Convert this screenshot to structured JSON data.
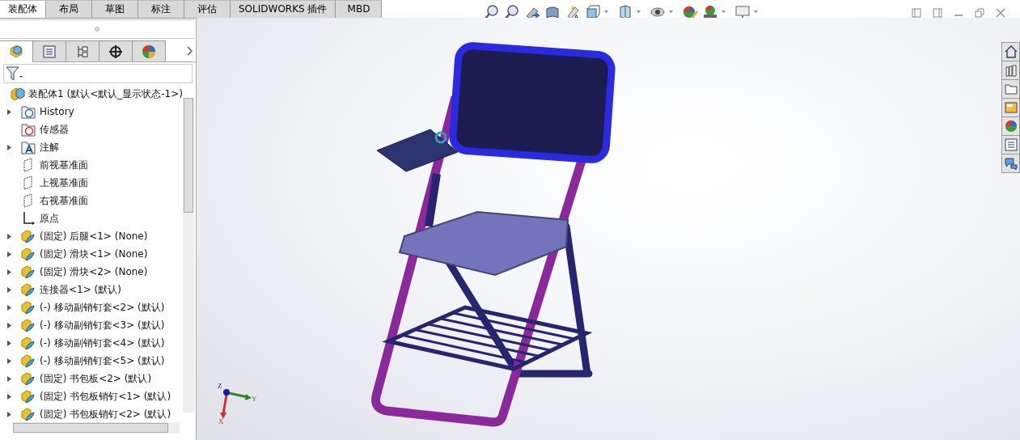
{
  "command_tabs": [
    {
      "label": "装配体",
      "selected": true
    },
    {
      "label": "布局",
      "selected": false
    },
    {
      "label": "草图",
      "selected": false
    },
    {
      "label": "标注",
      "selected": false
    },
    {
      "label": "评估",
      "selected": false
    },
    {
      "label": "SOLIDWORKS 插件",
      "selected": false
    },
    {
      "label": "MBD",
      "selected": false
    }
  ],
  "panel_tabs": [
    {
      "kind": "feature",
      "selected": true
    },
    {
      "kind": "property",
      "selected": false
    },
    {
      "kind": "config",
      "selected": false
    },
    {
      "kind": "dim",
      "selected": false
    },
    {
      "kind": "display",
      "selected": false
    }
  ],
  "tree": {
    "root": "装配体1  (默认<默认_显示状态-1>)",
    "items": [
      {
        "kind": "history",
        "label": "History",
        "expandable": true
      },
      {
        "kind": "sensor",
        "label": "传感器",
        "expandable": false
      },
      {
        "kind": "annotation",
        "label": "注解",
        "expandable": true
      },
      {
        "kind": "plane",
        "label": "前视基准面",
        "expandable": false
      },
      {
        "kind": "plane",
        "label": "上视基准面",
        "expandable": false
      },
      {
        "kind": "plane",
        "label": "右视基准面",
        "expandable": false
      },
      {
        "kind": "origin",
        "label": "原点",
        "expandable": false
      },
      {
        "kind": "part",
        "label": "(固定) 后腿<1> (None)",
        "expandable": true
      },
      {
        "kind": "part",
        "label": "(固定) 滑块<1> (None)",
        "expandable": true
      },
      {
        "kind": "part",
        "label": "(固定) 滑块<2> (None)",
        "expandable": true
      },
      {
        "kind": "part",
        "label": "连接器<1> (默认)",
        "expandable": true
      },
      {
        "kind": "part",
        "label": "(-) 移动副销钉套<2> (默认)",
        "expandable": true
      },
      {
        "kind": "part",
        "label": "(-) 移动副销钉套<3> (默认)",
        "expandable": true
      },
      {
        "kind": "part",
        "label": "(-) 移动副销钉套<4> (默认)",
        "expandable": true
      },
      {
        "kind": "part",
        "label": "(-) 移动副销钉套<5> (默认)",
        "expandable": true
      },
      {
        "kind": "part",
        "label": "(固定) 书包板<2> (默认)",
        "expandable": true
      },
      {
        "kind": "part",
        "label": "(固定) 书包板销钉<1> (默认)",
        "expandable": true
      },
      {
        "kind": "part",
        "label": "(固定) 书包板销钉<2> (默认)",
        "expandable": true
      }
    ]
  },
  "triad": {
    "x": "X",
    "y": "Y",
    "z": "Z"
  }
}
